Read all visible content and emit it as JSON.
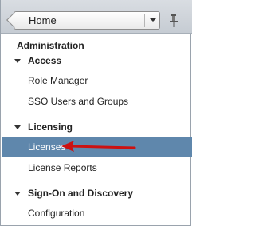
{
  "header": {
    "home_label": "Home",
    "dropdown_icon": "chevron-down-icon",
    "pin_icon": "pin-icon"
  },
  "nav": {
    "section_title": "Administration",
    "groups": [
      {
        "label": "Access",
        "items": [
          "Role Manager",
          "SSO Users and Groups"
        ]
      },
      {
        "label": "Licensing",
        "items": [
          "Licenses",
          "License Reports"
        ]
      },
      {
        "label": "Sign-On and Discovery",
        "items": [
          "Configuration"
        ]
      }
    ],
    "selected_item": "Licenses"
  },
  "colors": {
    "selection": "#5f87ac",
    "annotation_arrow": "#cc1111"
  }
}
